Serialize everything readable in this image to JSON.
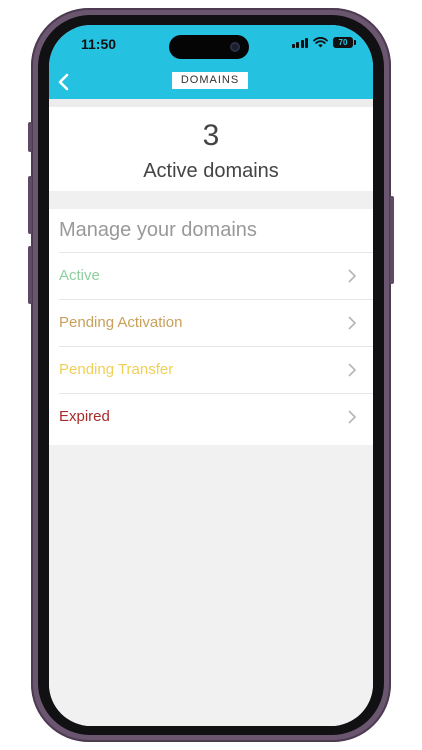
{
  "status_bar": {
    "time": "11:50",
    "battery": "70"
  },
  "header": {
    "title": "DOMAINS",
    "background_color": "#25c1e0"
  },
  "summary": {
    "count": "3",
    "label": "Active domains"
  },
  "manage": {
    "title": "Manage your domains",
    "items": [
      {
        "label": "Active",
        "color": "#8fcf9e"
      },
      {
        "label": "Pending Activation",
        "color": "#c8a05a"
      },
      {
        "label": "Pending Transfer",
        "color": "#f0cf56"
      },
      {
        "label": "Expired",
        "color": "#a82a2a"
      }
    ]
  }
}
